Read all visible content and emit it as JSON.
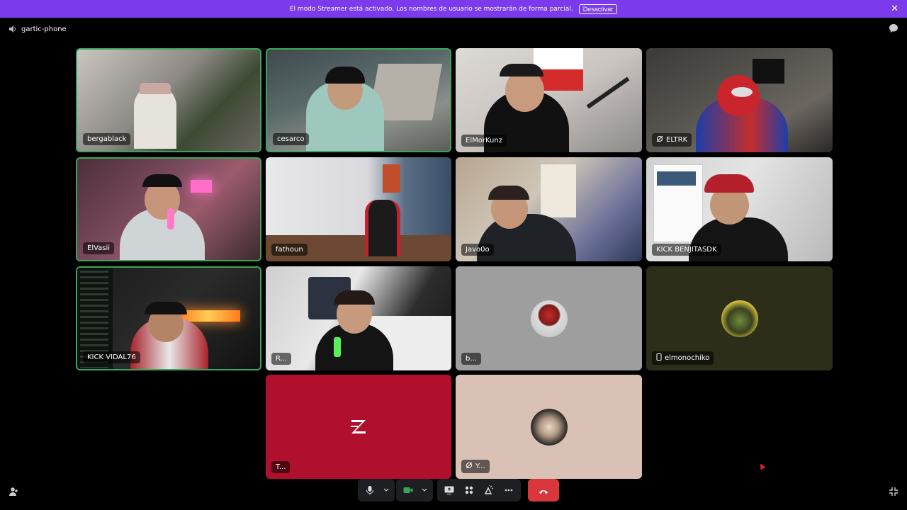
{
  "banner": {
    "text": "El modo Streamer está activado. Los nombres de usuario se mostrarán de forma parcial.",
    "button_label": "Desactivar",
    "close_glyph": "✕"
  },
  "channel": {
    "name": "gartic-phone",
    "icon": "speaker-icon"
  },
  "participants": [
    {
      "name": "bergablack",
      "speaking": true,
      "video": true
    },
    {
      "name": "cesarco",
      "speaking": true,
      "video": true
    },
    {
      "name": "ElMorKunz",
      "speaking": false,
      "video": true
    },
    {
      "name": "ELTRK",
      "speaking": false,
      "video": true,
      "icon": "stream-off-icon"
    },
    {
      "name": "ElVasii",
      "speaking": true,
      "video": true
    },
    {
      "name": "fathoun",
      "speaking": false,
      "video": true
    },
    {
      "name": "Javo0o",
      "speaking": false,
      "video": true
    },
    {
      "name": "KICK BENJITASDK",
      "speaking": false,
      "video": true
    },
    {
      "name": "KICK VIDAL76",
      "speaking": true,
      "video": true
    },
    {
      "name": "R...",
      "speaking": false,
      "video": true
    },
    {
      "name": "b...",
      "speaking": false,
      "video": false
    },
    {
      "name": "elmonochiko",
      "speaking": false,
      "video": false,
      "icon": "mobile-icon"
    },
    {
      "name": "T...",
      "speaking": false,
      "video": false
    },
    {
      "name": "Y...",
      "speaking": false,
      "video": false,
      "icon": "stream-off-icon"
    }
  ],
  "colors": {
    "accent_purple": "#7c3aed",
    "speaking_green": "#3ba55d",
    "end_call_red": "#da373c",
    "control_bg": "#1e1f22"
  },
  "controls": {
    "icons": [
      "microphone-icon",
      "chevron-down-icon",
      "camera-icon",
      "chevron-down-icon",
      "screen-share-icon",
      "activities-icon",
      "soundboard-icon",
      "more-icon",
      "end-call-icon"
    ]
  }
}
